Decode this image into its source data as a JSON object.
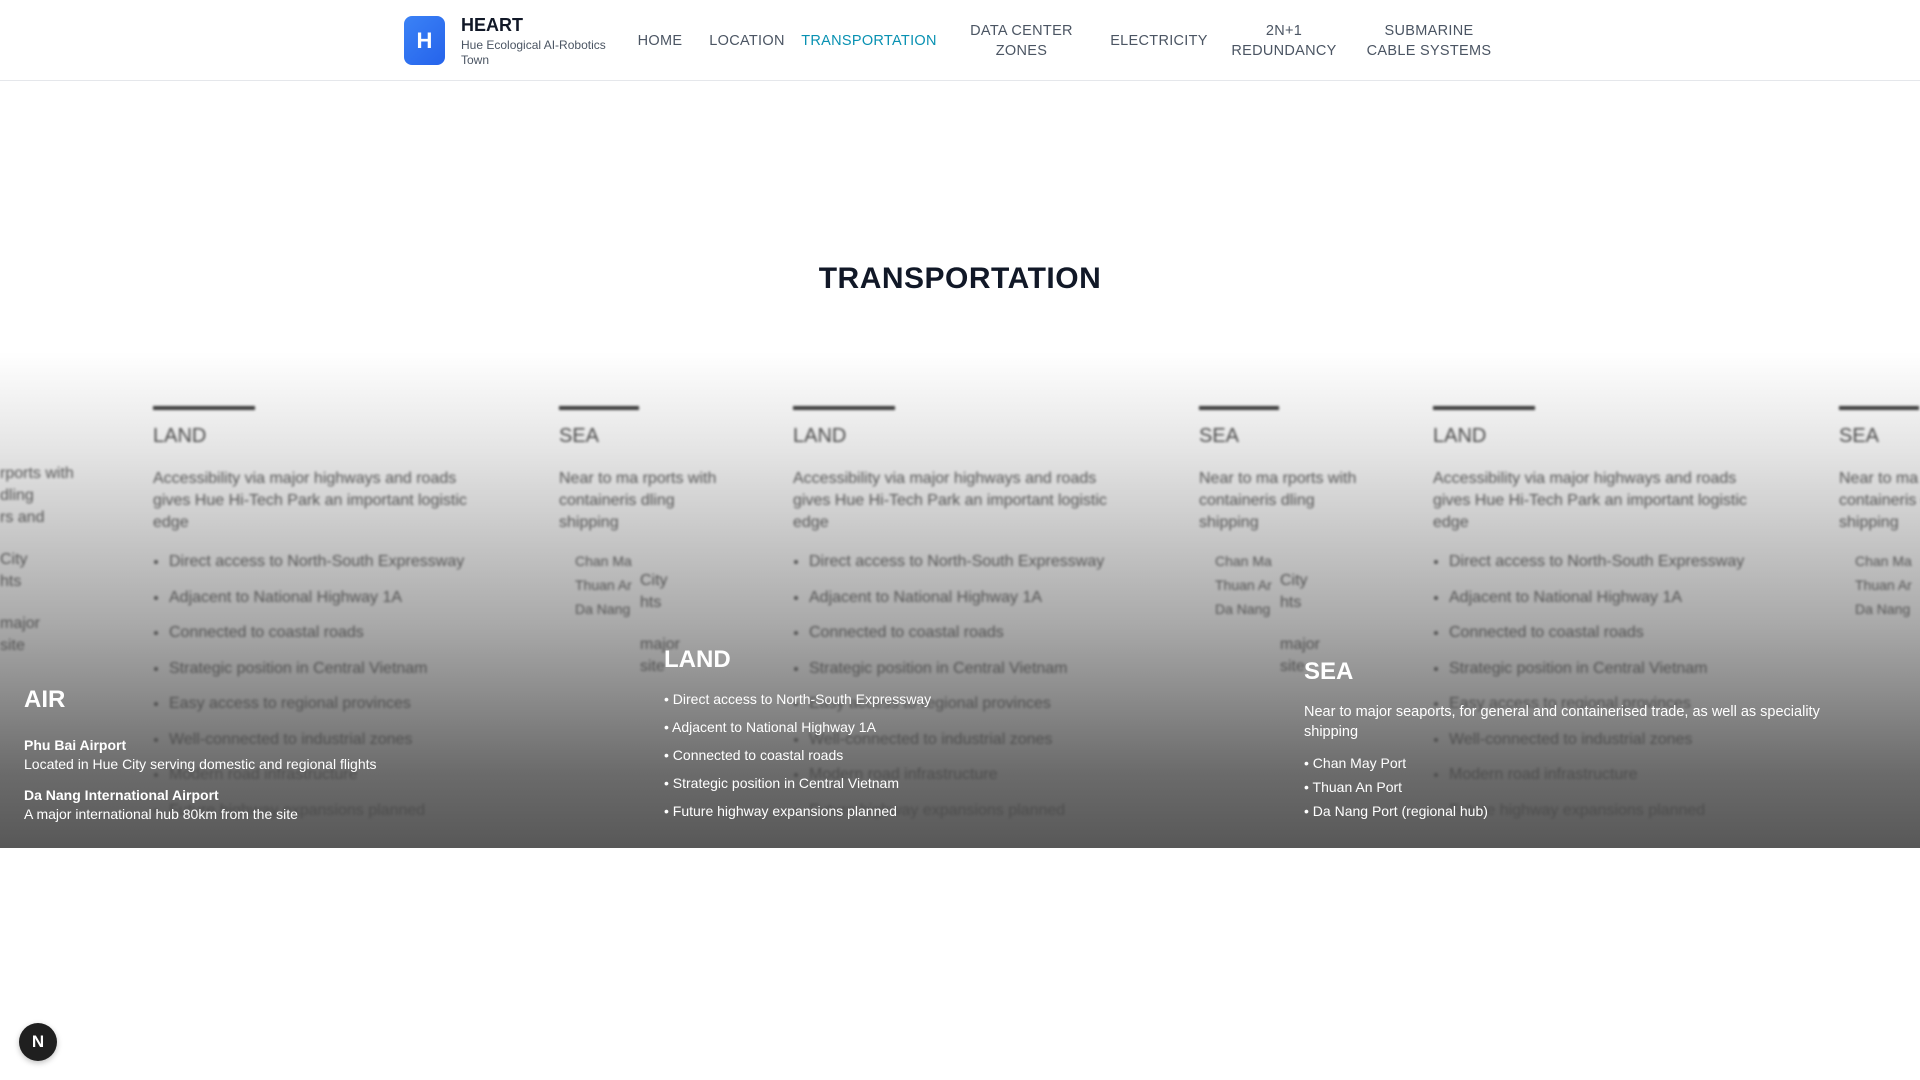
{
  "brand": {
    "logo_letter": "H",
    "title": "HEART",
    "subtitle": "Hue Ecological AI-Robotics Town"
  },
  "nav": {
    "items": [
      {
        "label": "HOME",
        "active": false
      },
      {
        "label": "LOCATION",
        "active": false
      },
      {
        "label": "TRANSPORTATION",
        "active": true
      },
      {
        "label": "DATA CENTER ZONES",
        "active": false
      },
      {
        "label": "ELECTRICITY",
        "active": false
      },
      {
        "label": "2N+1 REDUNDANCY",
        "active": false
      },
      {
        "label": "SUBMARINE CABLE SYSTEMS",
        "active": false
      }
    ],
    "active_color": "#0891b2"
  },
  "section": {
    "title": "TRANSPORTATION"
  },
  "ghost": {
    "land": {
      "title": "LAND",
      "desc": "Accessibility via major highways and roads gives Hue Hi-Tech Park an important logistic edge",
      "items": [
        "Direct access to North-South Expressway",
        "Adjacent to National Highway 1A",
        "Connected to coastal roads",
        "Strategic position in Central Vietnam",
        "Easy access to regional provinces",
        "Well-connected to industrial zones",
        "Modern road infrastructure",
        "Future highway expansions planned"
      ]
    },
    "sea": {
      "title": "SEA",
      "desc": "Near to ma rports with containeris dling shipping",
      "items": [
        "Chan Ma",
        "Thuan Ar",
        "Da Nang"
      ]
    },
    "fragments": {
      "a1": "rports with",
      "a2": "dling",
      "a3": "rs and",
      "b1": "City",
      "b2": "hts",
      "c1": "major",
      "c2": "site"
    }
  },
  "cards": {
    "air": {
      "title": "AIR",
      "airports": [
        {
          "name": "Phu Bai Airport",
          "desc": "Located in Hue City serving domestic and regional flights"
        },
        {
          "name": "Da Nang International Airport",
          "desc": "A major international hub 80km from the site"
        }
      ]
    },
    "land": {
      "title": "LAND",
      "items": [
        "Direct access to North-South Expressway",
        "Adjacent to National Highway 1A",
        "Connected to coastal roads",
        "Strategic position in Central Vietnam",
        "Future highway expansions planned"
      ]
    },
    "sea": {
      "title": "SEA",
      "desc": "Near to major seaports, for general and containerised trade, as well as speciality shipping",
      "items": [
        "Chan May Port",
        "Thuan An Port",
        "Da Nang Port (regional hub)"
      ]
    }
  },
  "fab": {
    "letter": "N"
  }
}
